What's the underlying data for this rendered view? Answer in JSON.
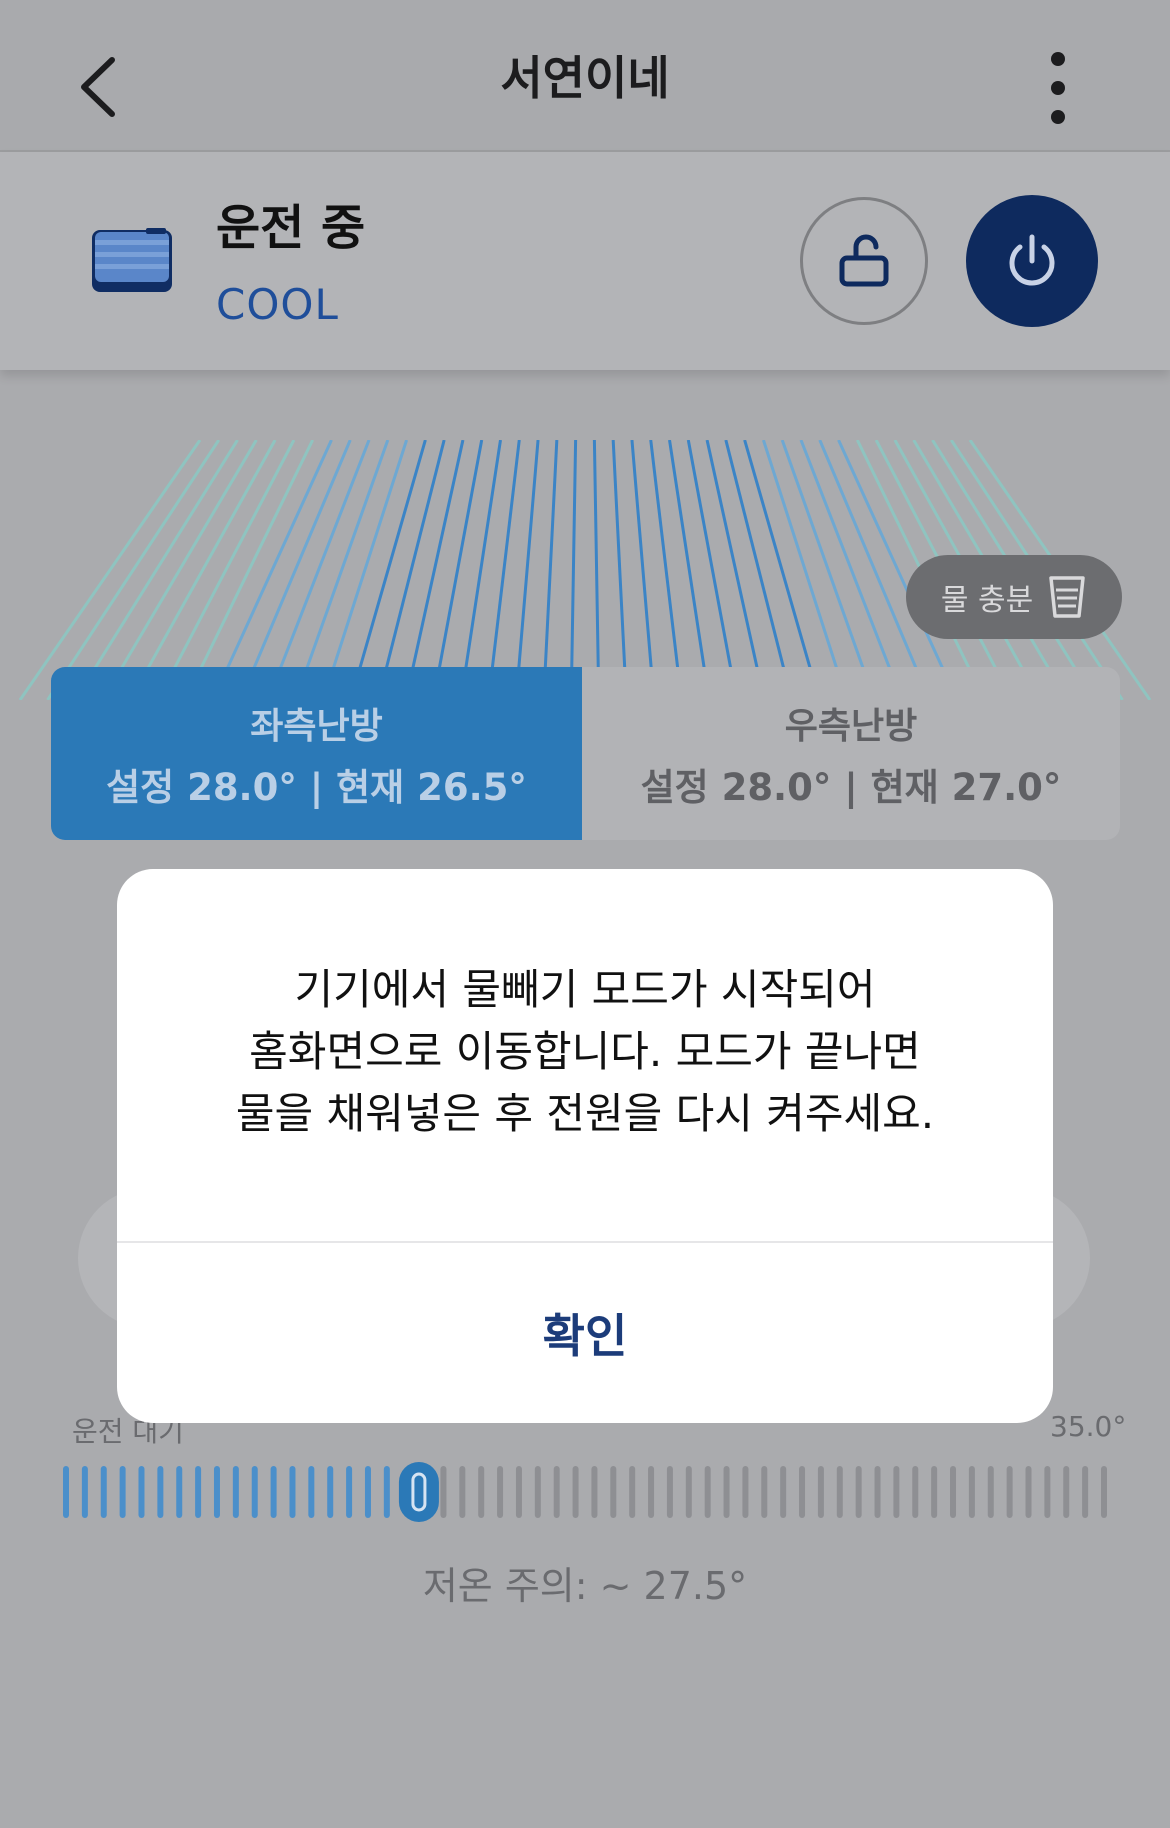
{
  "header": {
    "title": "서연이네"
  },
  "status": {
    "state": "운전 중",
    "mode": "COOL"
  },
  "water_badge": {
    "label": "물 충분"
  },
  "zones": [
    {
      "name": "좌측난방",
      "temps": "설정 28.0° | 현재 26.5°",
      "selected": true
    },
    {
      "name": "우측난방",
      "temps": "설정 28.0° | 현재 27.0°",
      "selected": false
    }
  ],
  "slider": {
    "left_label": "운전 대기",
    "right_label": "35.0°",
    "caption": "저온 주의: ~ 27.5°",
    "value_fraction": 0.34
  },
  "modal": {
    "message": "기기에서 물빼기 모드가 시작되어\n홈화면으로 이동합니다. 모드가 끝나면\n물을 채워넣은 후 전원을 다시 켜주세요.",
    "confirm_label": "확인"
  },
  "colors": {
    "accent": "#2b79b7",
    "power": "#0e2a5e",
    "confirm_text": "#1c3c7a"
  }
}
